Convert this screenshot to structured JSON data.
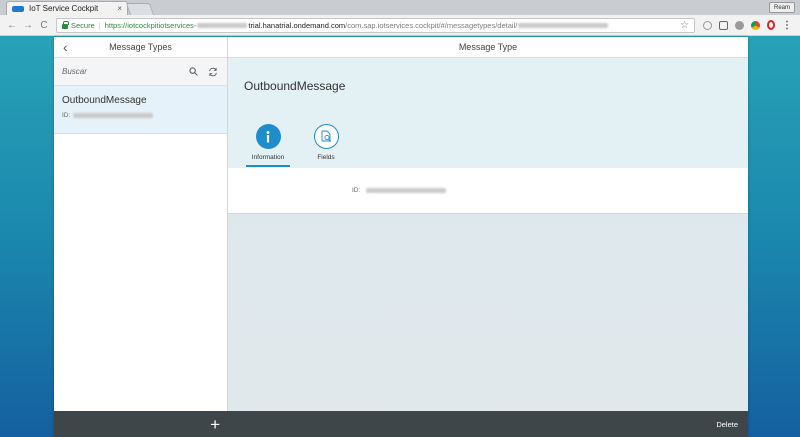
{
  "browser": {
    "tab_title": "IoT Service Cockpit",
    "tab_close": "×",
    "profile_badge": "Ream",
    "back": "←",
    "forward": "→",
    "reload": "C",
    "secure_label": "Secure",
    "url_part_1": "https://iotcockpitiotservices-",
    "url_part_2": "trial.hanatrial.ondemand.com",
    "url_part_3": "/com.sap.iotservices.cockpit/#/messagetypes/detail/",
    "star": "☆",
    "menu": "⋮"
  },
  "master": {
    "back_icon": "‹",
    "title": "Message Types",
    "search_placeholder": "Buscar",
    "items": [
      {
        "title": "OutboundMessage",
        "id_label": "ID:"
      }
    ]
  },
  "detail": {
    "header": "Message Type",
    "title": "OutboundMessage",
    "tabs": [
      {
        "label": "Information",
        "icon": "info-icon"
      },
      {
        "label": "Fields",
        "icon": "fields-search-icon"
      }
    ],
    "id_label": "ID:",
    "delete_label": "Delete"
  },
  "footer": {
    "add": "+"
  },
  "colors": {
    "accent": "#1f8ccc",
    "footer": "#3f4649",
    "selected_item": "#e6f2f9",
    "secure_green": "#2e8b3e"
  }
}
